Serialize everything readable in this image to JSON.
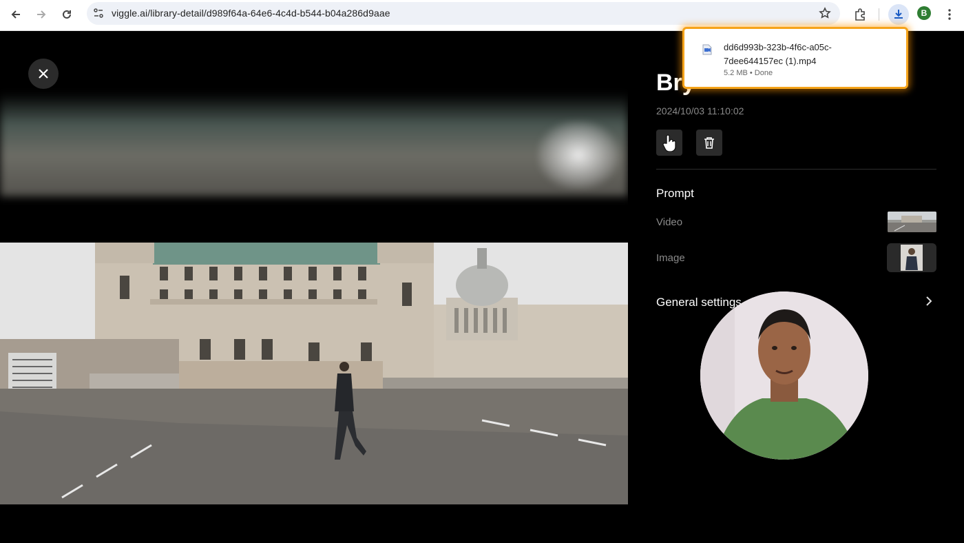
{
  "browser": {
    "url": "viggle.ai/library-detail/d989f64a-64e6-4c4d-b544-b04a286d9aae",
    "profile_initial": "B",
    "icons": [
      "back-icon",
      "forward-icon",
      "reload-icon",
      "site-info-icon",
      "bookmark-star-icon",
      "extensions-icon",
      "download-icon",
      "more-menu-icon"
    ]
  },
  "download": {
    "filename": "dd6d993b-323b-4f6c-a05c-7dee644157ec (1).mp4",
    "status": "5.2 MB • Done"
  },
  "detail": {
    "title": "Bry",
    "date": "2024/10/03 11:10:02",
    "prompt_heading": "Prompt",
    "video_label": "Video",
    "image_label": "Image",
    "general_settings": "General settings"
  },
  "colors": {
    "accent_highlight": "#f5a31a",
    "panel_bg": "#000000",
    "muted_text": "#8a8a8a"
  }
}
